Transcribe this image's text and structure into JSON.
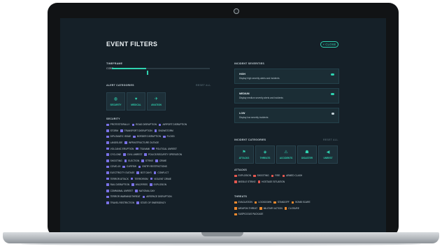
{
  "page": {
    "title": "EVENT FILTERS",
    "close_label": "× CLOSE"
  },
  "timeframe": {
    "label": "TIMEFRAME",
    "value": "COBS",
    "slider_level": 0.35
  },
  "alert_categories": {
    "label": "ALERT CATEGORIES",
    "reset_label": "RESET ALL",
    "buttons": [
      {
        "label": "SECURITY",
        "icon": "globe-icon"
      },
      {
        "label": "MEDICAL",
        "icon": "heart-icon"
      },
      {
        "label": "AVIATION",
        "icon": "plane-icon"
      }
    ]
  },
  "security": {
    "label": "SECURITY",
    "rows": [
      [
        "PROTESTS/RALLY",
        "ROAD DISRUPTION",
        "AIRPORT DISRUPTION"
      ],
      [
        "STORM",
        "TRANSPORT DISRUPTION",
        "SNOWSTORM"
      ],
      [
        "DIPLOMATIC ISSUE",
        "BORDER DISRUPTION",
        "FLOOD"
      ],
      [
        "LANDSLIDE",
        "INFRASTRUCTURE OUTAGE"
      ],
      [
        "VOLCANIC ERUPTION",
        "TSUNAMI",
        "POLITICAL UNREST"
      ],
      [
        "CYCLONE",
        "CIVIL UNREST",
        "POLICE/SECURITY OPERATION"
      ],
      [
        "SHOOTING",
        "ELECTION",
        "STRIKE",
        "CRIME"
      ],
      [
        "COVID-19",
        "CURFEW",
        "ENTRY RESTRICTIONS"
      ],
      [
        "ELECTRICITY OUTAGE",
        "BOT DAYS",
        "CONFLICT"
      ],
      [
        "TERROR ATTACK",
        "TERRORISM",
        "VIOLENT CRIME"
      ],
      [
        "RAIL DISRUPTION",
        "WILDFIRES",
        "EXPLOSION"
      ],
      [
        "COMMUNAL UNREST",
        "NATIONAL DAY"
      ],
      [
        "TERROR WARNING/THREAT",
        "AIRSPACE DISRUPTION"
      ],
      [
        "TRAVEL RESTRICTION",
        "STATE OF EMERGENCY"
      ]
    ]
  },
  "incident_severities": {
    "label": "INCIDENT SEVERITIES",
    "cards": [
      {
        "name": "HIGH",
        "desc": "Display high severity alerts and incidents",
        "on": true
      },
      {
        "name": "MEDIUM",
        "desc": "Display medium severity alerts and incidents",
        "on": true
      },
      {
        "name": "LOW",
        "desc": "Display low severity incidents",
        "on": false
      }
    ]
  },
  "incident_categories": {
    "label": "INCIDENT CATEGORIES",
    "reset_label": "RESET ALL",
    "buttons": [
      {
        "label": "ATTACKS",
        "icon": "attack-icon"
      },
      {
        "label": "THREATS",
        "icon": "target-icon"
      },
      {
        "label": "ACCIDENTS",
        "icon": "accident-icon"
      },
      {
        "label": "DISASTER",
        "icon": "disaster-icon"
      },
      {
        "label": "UNREST",
        "icon": "megaphone-icon"
      }
    ]
  },
  "attacks": {
    "label": "ATTACKS",
    "rows": [
      [
        "EXPLOSION",
        "SHOOTING",
        "FIRE",
        "ARMED CLASH"
      ],
      [
        "MISSILE STRIKE",
        "HOSTAGE SITUATION"
      ]
    ]
  },
  "threats": {
    "label": "THREATS",
    "rows": [
      [
        "EVACUATION",
        "LOCKDOWN",
        "STANDOFF",
        "BOMB SCARE"
      ],
      [
        "WEAPON THREAT",
        "MILITARY ACTION",
        "CLOSURE"
      ],
      [
        "SUSPICIOUS PACKAGE"
      ]
    ]
  },
  "colors": {
    "accent": "#2fd3b0",
    "security_check": "#7a72e8",
    "attacks_check": "#e5574f",
    "threats_check": "#f08a2e",
    "screen_bg": "#152028"
  }
}
